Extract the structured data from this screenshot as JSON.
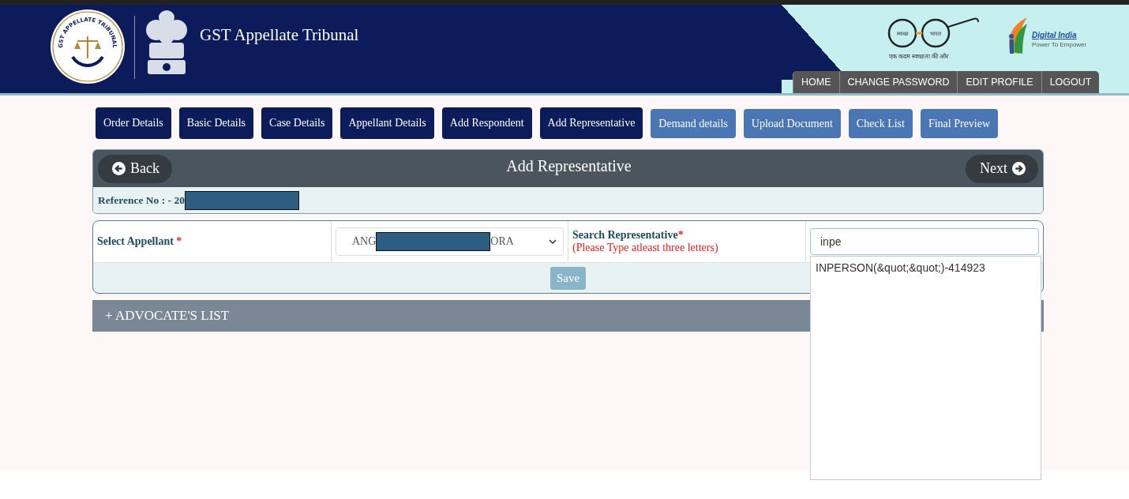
{
  "header": {
    "title": "GST Appellate Tribunal",
    "seal_text": "GST APPELLATE TRIBUNAL",
    "swachh": {
      "left": "स्वच्छ",
      "right": "भारत",
      "tagline": "एक कदम स्वच्छता की ओर"
    },
    "digital_india": {
      "name": "Digital India",
      "tagline": "Power To Empower"
    },
    "nav": [
      "HOME",
      "CHANGE PASSWORD",
      "EDIT PROFILE",
      "LOGOUT"
    ]
  },
  "steps": [
    {
      "label": "Order Details",
      "completed": true
    },
    {
      "label": "Basic Details",
      "completed": true
    },
    {
      "label": "Case Details",
      "completed": true
    },
    {
      "label": "Appellant Details",
      "completed": true
    },
    {
      "label": "Add Respondent",
      "completed": true
    },
    {
      "label": "Add Representative",
      "completed": true
    },
    {
      "label": "Demand details",
      "completed": false
    },
    {
      "label": "Upload Document",
      "completed": false
    },
    {
      "label": "Check List",
      "completed": false
    },
    {
      "label": "Final Preview",
      "completed": false
    }
  ],
  "panel": {
    "back": "Back",
    "title": "Add Representative",
    "next": "Next",
    "reference": "Reference No : - 20"
  },
  "form": {
    "appellant_label": "Select Appellant",
    "required_mark": "*",
    "appellant_value_start": "ANG",
    "appellant_value_end": "ORA",
    "search_label": "Search Representative",
    "search_required_mark": "*",
    "search_hint": "(Please Type atleast three letters)",
    "search_value": "inpe",
    "suggestions": [
      "INPERSON(&quot;&quot;)-414923"
    ],
    "save": "Save"
  },
  "advocates": {
    "label": "+ ADVOCATE'S LIST",
    "expanded": false
  }
}
